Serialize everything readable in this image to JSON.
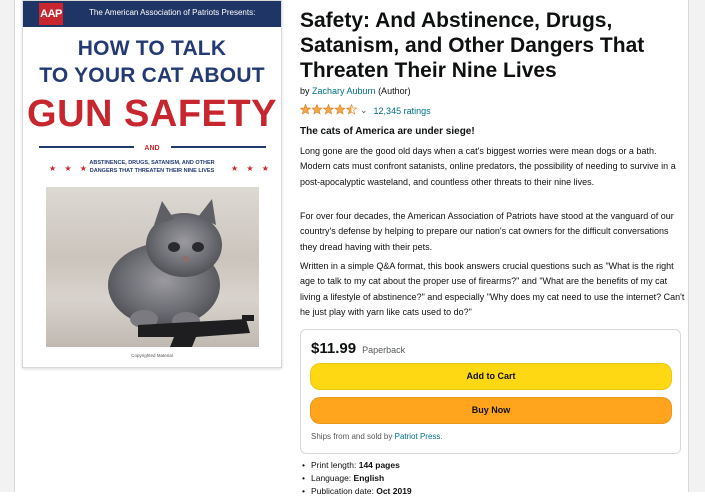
{
  "cover": {
    "logo_text": "AAP",
    "presents": "The American Association of Patriots Presents:",
    "title_line1": "HOW TO TALK",
    "title_line2": "TO YOUR CAT ABOUT",
    "title_main": "GUN SAFETY",
    "and": "AND",
    "subtitle": "ABSTINENCE, DRUGS, SATANISM, AND OTHER DANGERS THAT THREATEN THEIR NINE LIVES",
    "caption": "Copyrighted Material",
    "stars": "★ ★ ★"
  },
  "product": {
    "title": "Safety: And Abstinence, Drugs, Satanism, and Other Dangers That Threaten Their Nine Lives",
    "by_prefix": "by ",
    "author": "Zachary Auburn",
    "author_role": " (Author)",
    "rating": 4.5,
    "rating_count": "12,345 ratings",
    "tagline": "The cats of America are under siege!",
    "paragraphs": [
      "Long gone are the good old days when a cat's biggest worries were mean dogs or a bath. Modern cats must confront satanists, online predators, the possibility of needing to survive in a post-apocalyptic wasteland, and countless other threats to their nine lives.",
      "For over four decades, the American Association of Patriots have stood at the vanguard of our country's defense by helping to prepare our nation's cat owners for the difficult conversations they dread having with their pets.",
      "Written in a simple Q&A format, this book answers crucial questions such as \"What is the right age to talk to my cat about the proper use of firearms?\" and \"What are the benefits of my cat living a lifestyle of abstinence?\" and especially \"Why does my cat need to use the internet? Can't he just play with yarn like cats used to do?\""
    ]
  },
  "buybox": {
    "price": "$11.99",
    "format": "Paperback",
    "add_to_cart": "Add to Cart",
    "buy_now": "Buy Now",
    "ships_prefix": "Ships from and sold by ",
    "seller": "Patriot Press",
    "ships_suffix": "."
  },
  "details": [
    {
      "label": "Print length: ",
      "value": "144 pages"
    },
    {
      "label": "Language: ",
      "value": "English"
    },
    {
      "label": "Publication date: ",
      "value": "Oct 2019"
    }
  ],
  "colors": {
    "cover_navy": "#233a73",
    "cover_red": "#c8262e",
    "link": "#007185",
    "star": "#f3a847",
    "add_to_cart": "#ffd814",
    "buy_now": "#ffa41c"
  }
}
